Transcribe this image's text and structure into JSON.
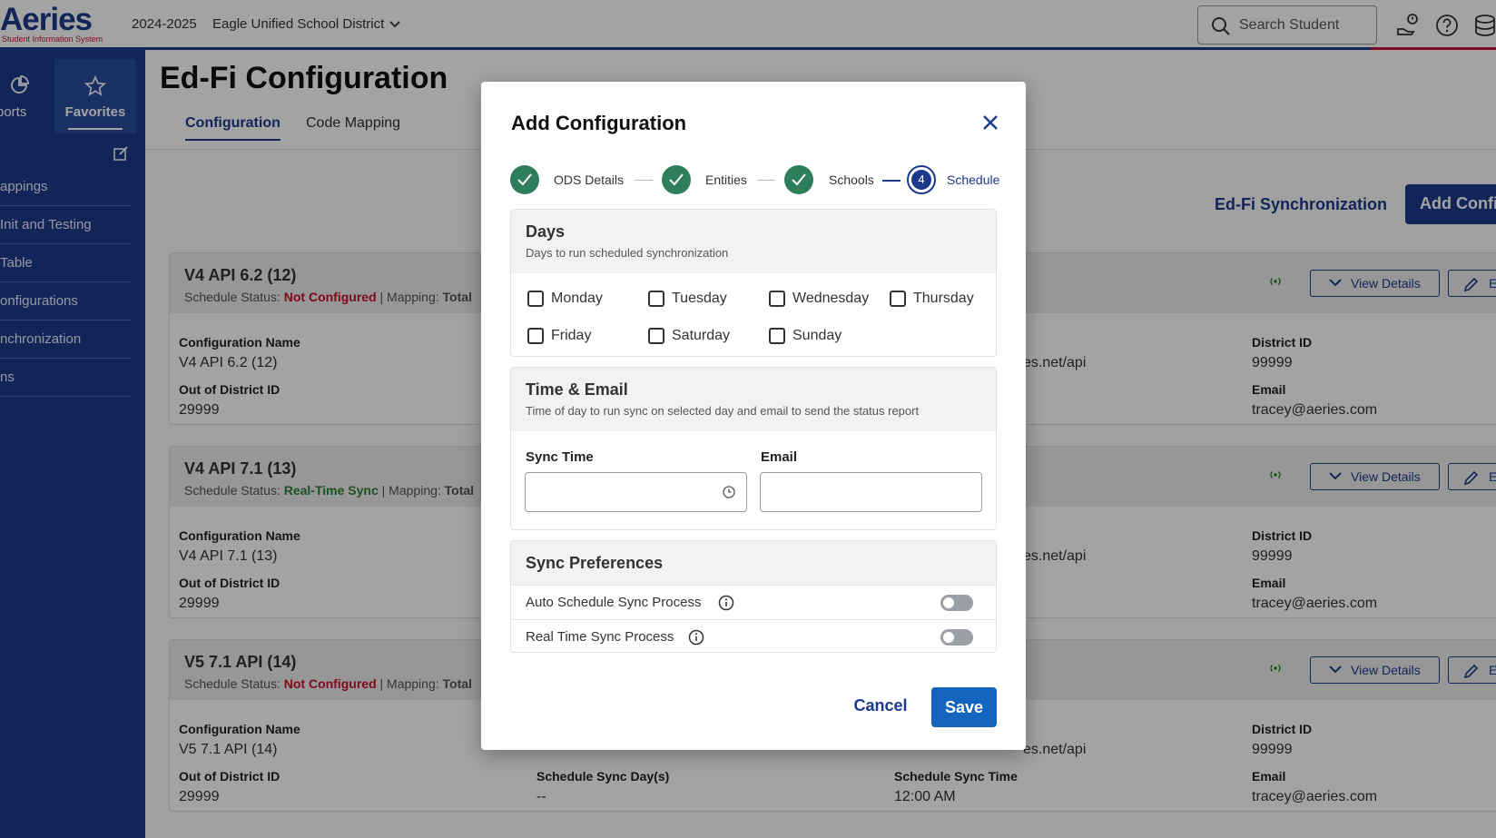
{
  "header": {
    "logo_text": "Aeries",
    "logo_tagline": "Student Information System",
    "school_year": "2024-2025",
    "district": "Eagle Unified School District",
    "search_placeholder": "Search Student"
  },
  "sidebar": {
    "tabs": [
      {
        "label": "ports"
      },
      {
        "label": "Favorites"
      }
    ],
    "items": [
      {
        "label": "appings"
      },
      {
        "label": "Init and Testing"
      },
      {
        "label": "Table"
      },
      {
        "label": "onfigurations"
      },
      {
        "label": "nchronization"
      },
      {
        "label": "ns"
      }
    ]
  },
  "main": {
    "title": "Ed-Fi Configuration",
    "tabs": [
      {
        "label": "Configuration"
      },
      {
        "label": "Code Mapping"
      }
    ],
    "sync_link": "Ed-Fi Synchronization",
    "add_button": "Add Configuration",
    "view_details_label": "View Details",
    "edit_label": "Edit",
    "cards": [
      {
        "title": "V4 API 6.2 (12)",
        "status_prefix": "Schedule Status: ",
        "status": "Not Configured",
        "mapping_prefix": " | Mapping: ",
        "mapping": "Total",
        "config_name_label": "Configuration Name",
        "config_name": "V4 API 6.2 (12)",
        "ood_label": "Out of District ID",
        "ood": "29999",
        "url_tail": "es.net/api",
        "district_id_label": "District ID",
        "district_id": "99999",
        "email_label": "Email",
        "email": "tracey@aeries.com"
      },
      {
        "title": "V4 API 7.1 (13)",
        "status_prefix": "Schedule Status: ",
        "status": "Real-Time Sync",
        "mapping_prefix": " | Mapping: ",
        "mapping": "Total",
        "config_name_label": "Configuration Name",
        "config_name": "V4 API 7.1 (13)",
        "ood_label": "Out of District ID",
        "ood": "29999",
        "url_tail": "es.net/api",
        "district_id_label": "District ID",
        "district_id": "99999",
        "email_label": "Email",
        "email": "tracey@aeries.com"
      },
      {
        "title": "V5 7.1 API (14)",
        "status_prefix": "Schedule Status: ",
        "status": "Not Configured",
        "mapping_prefix": " | Mapping: ",
        "mapping": "Total",
        "config_name_label": "Configuration Name",
        "config_name": "V5 7.1 API (14)",
        "ood_label": "Out of District ID",
        "ood": "29999",
        "url_tail": "es.net/api",
        "district_id_label": "District ID",
        "district_id": "99999",
        "email_label": "Email",
        "email": "tracey@aeries.com",
        "sync_days_label": "Schedule Sync Day(s)",
        "sync_days": "--",
        "sync_time_label": "Schedule Sync Time",
        "sync_time": "12:00 AM"
      }
    ]
  },
  "modal": {
    "title": "Add Configuration",
    "steps": [
      {
        "label": "ODS Details",
        "state": "done"
      },
      {
        "label": "Entities",
        "state": "done"
      },
      {
        "label": "Schools",
        "state": "done"
      },
      {
        "label": "Schedule",
        "state": "current",
        "number": "4"
      }
    ],
    "days": {
      "title": "Days",
      "subtitle": "Days to run scheduled synchronization",
      "options": [
        "Monday",
        "Tuesday",
        "Wednesday",
        "Thursday",
        "Friday",
        "Saturday",
        "Sunday"
      ]
    },
    "time_email": {
      "title": "Time & Email",
      "subtitle": "Time of day to run sync on selected day and email to send the status report",
      "sync_time_label": "Sync Time",
      "sync_time_value": "",
      "email_label": "Email",
      "email_value": ""
    },
    "preferences": {
      "title": "Sync Preferences",
      "items": [
        {
          "label": "Auto Schedule Sync Process",
          "enabled": false
        },
        {
          "label": "Real Time Sync Process",
          "enabled": false
        }
      ]
    },
    "cancel_label": "Cancel",
    "save_label": "Save"
  },
  "colors": {
    "brand_blue": "#1b3a8c",
    "accent_red": "#c8102e",
    "step_done_green": "#2e7d5b",
    "save_blue": "#1565c0"
  }
}
